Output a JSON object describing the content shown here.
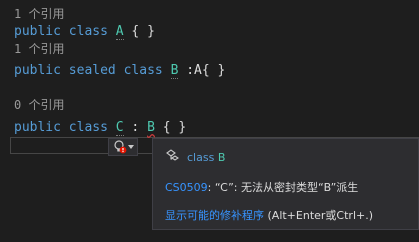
{
  "editor": {
    "lines": [
      {
        "codelens": "1 个引用"
      },
      {
        "kw1": "public",
        "kw2": "class",
        "name": "A",
        "rest": " { }"
      },
      {
        "codelens": "1 个引用"
      },
      {
        "kw1": "public",
        "kw2": "sealed",
        "kw3": "class",
        "name": "B",
        "rest": " :A{ }"
      },
      {
        "codelens": "0 个引用"
      },
      {
        "kw1": "public",
        "kw2": "class",
        "name": "C",
        "sep": " : ",
        "base": "B",
        "rest": " { }"
      }
    ]
  },
  "popup": {
    "signature_keyword": "class",
    "signature_name": "B",
    "error_code": "CS0509",
    "error_message": ": “C”: 无法从密封类型“B”派生",
    "fix_link": "显示可能的修补程序",
    "fix_shortcut": " (Alt+Enter或Ctrl+.)"
  },
  "colors": {
    "keyword": "#569cd6",
    "type": "#4ec9b0",
    "link": "#3794ff",
    "error_squiggle": "#c93c3c"
  },
  "icons": {
    "lightbulb": "error-lightbulb-icon",
    "class_symbol": "class-symbol-icon"
  }
}
